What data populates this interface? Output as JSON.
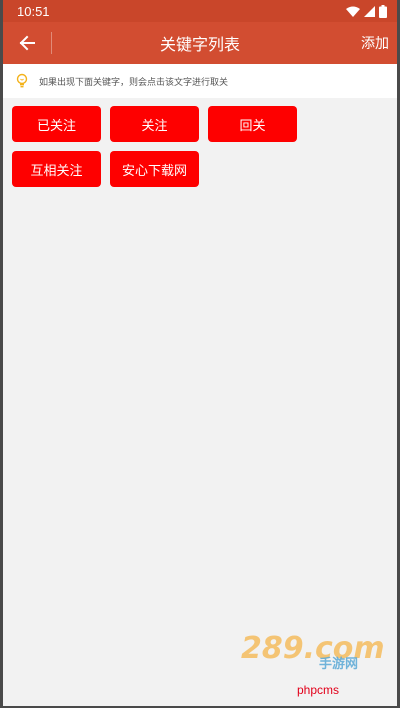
{
  "statusbar": {
    "time": "10:51",
    "icons": [
      "wifi-icon",
      "signal-icon",
      "battery-icon"
    ]
  },
  "appbar": {
    "title": "关键字列表",
    "action_label": "添加",
    "back_icon": "arrow-left-icon"
  },
  "hint": {
    "icon": "lightbulb-icon",
    "text": "如果出现下面关键字，则会点击该文字进行取关"
  },
  "keywords": [
    {
      "label": "已关注"
    },
    {
      "label": "关注"
    },
    {
      "label": "回关"
    },
    {
      "label": "互相关注"
    },
    {
      "label": "安心下载网"
    }
  ],
  "watermark": {
    "logo_text": "289.com",
    "logo_sub": "手游网",
    "site_text": "phpcms"
  },
  "colors": {
    "statusbar": "#c9462a",
    "appbar": "#d24d31",
    "chip": "#fe0000",
    "background": "#f2f2f2"
  }
}
